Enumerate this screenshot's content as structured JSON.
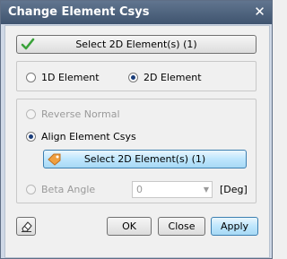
{
  "window": {
    "title": "Change Element Csys",
    "close_glyph": "✕"
  },
  "top_button": {
    "label": "Select 2D Element(s) (1)",
    "icon": "checkmark-icon",
    "icon_color": "#3aa23a"
  },
  "element_type": {
    "options": [
      {
        "label": "1D Element",
        "checked": false
      },
      {
        "label": "2D Element",
        "checked": true
      }
    ]
  },
  "orientation": {
    "reverse_normal": {
      "label": "Reverse Normal",
      "enabled": false
    },
    "align_csys": {
      "label": "Align Element Csys",
      "checked": true
    },
    "align_button": {
      "label": "Select 2D Element(s) (1)",
      "icon": "pick-icon",
      "icon_color": "#f0a040"
    },
    "beta_angle": {
      "label": "Beta Angle",
      "value": "0",
      "unit": "[Deg]",
      "enabled": false
    }
  },
  "footer": {
    "eraser_icon": "eraser-icon",
    "ok_label": "OK",
    "close_label": "Close",
    "apply_label": "Apply"
  }
}
